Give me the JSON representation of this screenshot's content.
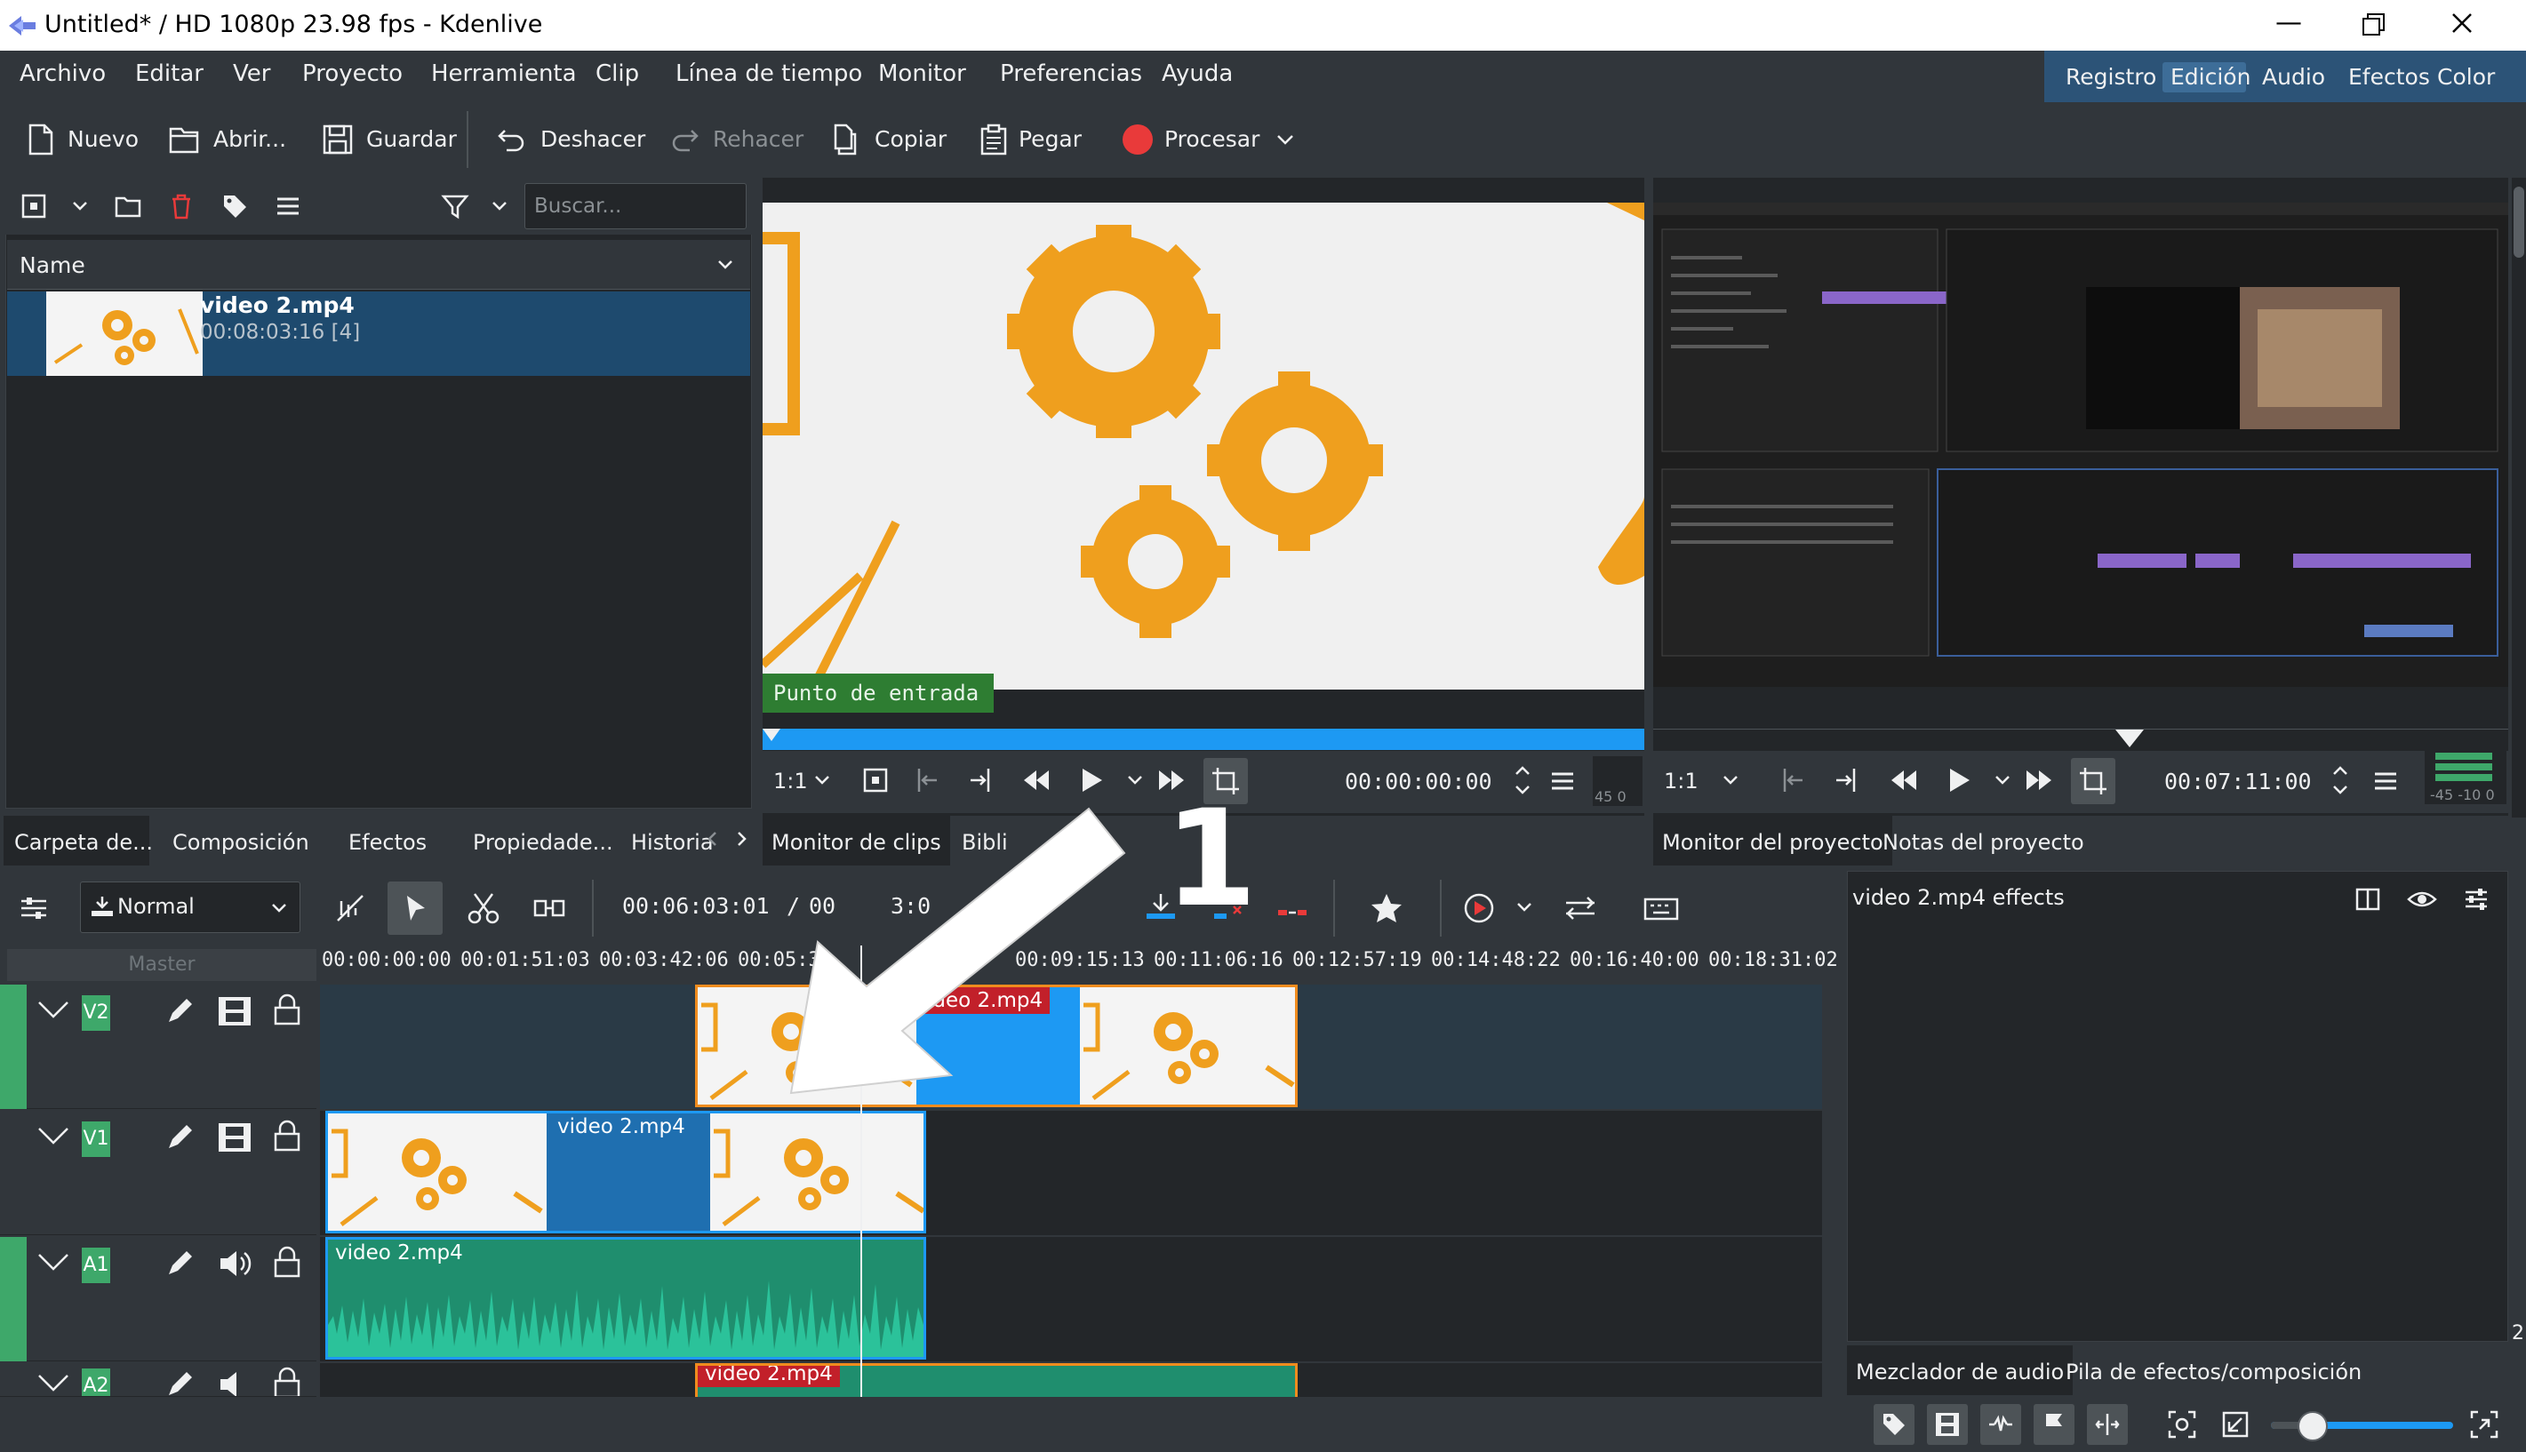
{
  "window": {
    "title": "Untitled* / HD 1080p 23.98 fps - Kdenlive",
    "minimize_label": "—"
  },
  "menu": [
    "Archivo",
    "Editar",
    "Ver",
    "Proyecto",
    "Herramienta",
    "Clip",
    "Línea de tiempo",
    "Monitor",
    "Preferencias",
    "Ayuda"
  ],
  "workspaces": [
    "Registro",
    "Edición",
    "Audio",
    "Efectos",
    "Color"
  ],
  "toolbar": {
    "nuevo": "Nuevo",
    "abrir": "Abrir...",
    "guardar": "Guardar",
    "deshacer": "Deshacer",
    "rehacer": "Rehacer",
    "copiar": "Copiar",
    "pegar": "Pegar",
    "procesar": "Procesar"
  },
  "bin": {
    "search_placeholder": "Buscar...",
    "column_name": "Name",
    "items": [
      {
        "name": "video 2.mp4",
        "duration": "00:08:03:16 [4]"
      }
    ]
  },
  "left_tabs": [
    "Carpeta de...",
    "Composición",
    "Efectos",
    "Propiedade...",
    "Historia"
  ],
  "clip_monitor": {
    "overlay": "Punto de entrada",
    "zoom": "1:1",
    "timecode": "00:00:00:00",
    "level": "45 0"
  },
  "project_monitor": {
    "zoom": "1:1",
    "timecode": "00:07:11:00",
    "level": "-45 -10 0"
  },
  "monitor_tabs": [
    "Monitor de clips",
    "Bibli"
  ],
  "project_tabs": [
    "Monitor del proyecto",
    "Notas del proyecto"
  ],
  "timeline": {
    "mode": "Normal",
    "position": "00:06:03:01",
    "separator": "/",
    "duration_partial": "00",
    "duration_tail": "3:0",
    "master_label": "Master",
    "ruler": [
      "00:00:00:00",
      "00:01:51:03",
      "00:03:42:06",
      "00:05:33",
      "00:09:15:13",
      "00:11:06:16",
      "00:12:57:19",
      "00:14:48:22",
      "00:16:40:00",
      "00:18:31:02"
    ],
    "tracks": [
      {
        "label": "V2",
        "type": "video"
      },
      {
        "label": "V1",
        "type": "video"
      },
      {
        "label": "A1",
        "type": "audio"
      },
      {
        "label": "A2",
        "type": "audio"
      }
    ],
    "clip_name": "video 2.mp4",
    "clip_name_v2": "ideo 2.mp4",
    "clip_name_a2": "video 2.mp4"
  },
  "effects": {
    "title": "video 2.mp4 effects",
    "tabs": [
      "Mezclador de audio",
      "Pila de efectos/composición"
    ],
    "side_digit": "2"
  },
  "annotation": {
    "number": "1"
  },
  "colors": {
    "accent": "#1d99f3",
    "selection": "#1e4a6e",
    "workspace_bar": "#2c5377",
    "track_green": "#3ea86a",
    "audio_wave": "#2bc29a",
    "gear": "#ef9f1e",
    "record": "#e93a3a",
    "clip_border_v2": "#f08c1e"
  },
  "icons": [
    "new-document-icon",
    "open-folder-icon",
    "save-icon",
    "undo-icon",
    "redo-icon",
    "copy-icon",
    "paste-icon",
    "record-icon",
    "chevron-down-icon",
    "filter-icon",
    "tag-icon",
    "trash-icon",
    "menu-icon",
    "play-icon",
    "rewind-icon",
    "fast-forward-icon",
    "crop-icon",
    "lock-icon",
    "film-icon",
    "speaker-icon",
    "pencil-icon",
    "star-icon",
    "scissors-icon",
    "pointer-icon",
    "eye-icon",
    "settings-icon",
    "keyboard-icon"
  ]
}
